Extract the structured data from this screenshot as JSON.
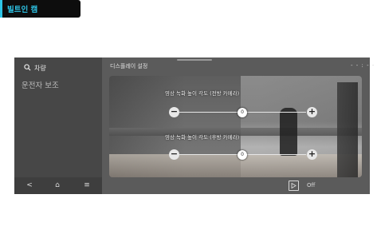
{
  "sidebar": {
    "search_label": "차량",
    "items": [
      {
        "label": "운전자 보조"
      },
      {
        "label": "빌트인 캠"
      }
    ]
  },
  "panel": {
    "title": "디스플레이 설정",
    "status": "- - : - -"
  },
  "sliders": [
    {
      "label": "영상 녹화 높이 각도 (전방 카메라)",
      "value": "0"
    },
    {
      "label": "영상 녹화 높이 각도 (후방 카메라)",
      "value": "0"
    }
  ],
  "buttons": {
    "minus": "−",
    "plus": "+"
  },
  "navbar": {
    "back": "<",
    "home": "⌂",
    "menu": "≡"
  },
  "bottom": {
    "toggle_label": "Off"
  },
  "colors": {
    "accent": "#2ec4e6",
    "background": "#5b5b5b",
    "sidebar": "#474747"
  }
}
